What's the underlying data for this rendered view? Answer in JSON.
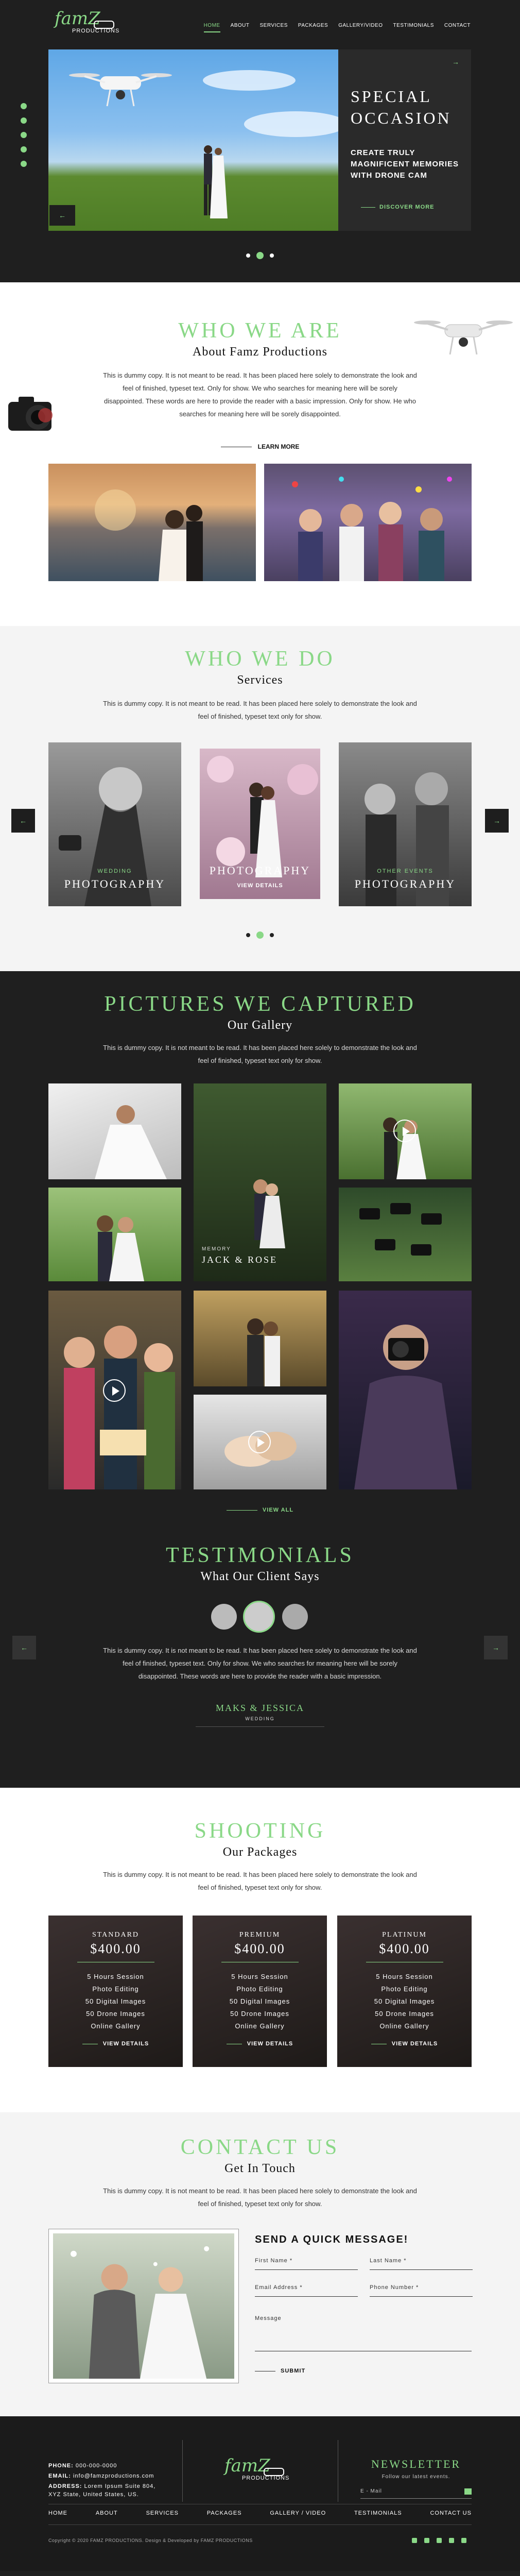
{
  "brand": {
    "script": "famZ",
    "sub": "PRODUCTIONS"
  },
  "nav": [
    "HOME",
    "ABOUT",
    "SERVICES",
    "PACKAGES",
    "GALLERY/VIDEO",
    "TESTIMONIALS",
    "CONTACT"
  ],
  "hero": {
    "title_line1": "SPECIAL",
    "title_line2": "OCCASION",
    "subtitle": "CREATE TRULY MAGNIFICENT MEMORIES WITH DRONE CAM",
    "cta": "DISCOVER MORE",
    "next_icon": "→",
    "prev_icon": "←"
  },
  "about": {
    "heading": "WHO WE ARE",
    "subheading": "About Famz Productions",
    "text": "This is dummy copy. It is not meant to be read. It has been placed here solely to demonstrate the look and feel of finished, typeset text. Only for show. We who searches for meaning here will be sorely disappointed. These words are here to provide the reader with a basic impression. Only for show. He who searches for meaning here will be sorely disappointed.",
    "cta": "LEARN MORE"
  },
  "services": {
    "heading": "WHO WE DO",
    "subheading": "Services",
    "text": "This is dummy copy. It is not meant to be read. It has been placed here solely to demonstrate the look and feel of finished, typeset text only for show.",
    "cards": [
      {
        "green": "WEDDING",
        "label": "PHOTOGRAPHY"
      },
      {
        "green": "",
        "label": "PHOTOGRAPHY",
        "cta": "VIEW DETAILS"
      },
      {
        "green": "OTHER EVENTS",
        "label": "PHOTOGRAPHY"
      }
    ]
  },
  "gallery": {
    "heading": "PICTURES WE CAPTURED",
    "subheading": "Our Gallery",
    "text": "This is dummy copy. It is not meant to be read. It has been placed here solely to demonstrate the look and feel of finished, typeset text only for show.",
    "memory_small": "MEMORY",
    "memory_title": "JACK & ROSE",
    "view_all": "VIEW ALL"
  },
  "testimonials": {
    "heading": "TESTIMONIALS",
    "subheading": "What Our Client Says",
    "text": "This is dummy copy. It is not meant to be read. It has been placed here solely to demonstrate the look and feel of finished, typeset text. Only for show. We who searches for meaning here will be sorely disappointed. These words are here to provide the reader with a basic impression.",
    "name": "MAKS & JESSICA",
    "role": "WEDDING"
  },
  "packages": {
    "heading": "SHOOTING",
    "subheading": "Our Packages",
    "text": "This is dummy copy. It is not meant to be read. It has been placed here solely to demonstrate the look and feel of finished, typeset text only for show.",
    "items": [
      {
        "name": "STANDARD",
        "price": "$400.00",
        "features": [
          "5 Hours Session",
          "Photo Editing",
          "50 Digital Images",
          "50 Drone Images",
          "Online Gallery"
        ],
        "cta": "VIEW DETAILS"
      },
      {
        "name": "PREMIUM",
        "price": "$400.00",
        "features": [
          "5 Hours Session",
          "Photo Editing",
          "50 Digital Images",
          "50 Drone Images",
          "Online Gallery"
        ],
        "cta": "VIEW DETAILS"
      },
      {
        "name": "PLATINUM",
        "price": "$400.00",
        "features": [
          "5 Hours Session",
          "Photo Editing",
          "50 Digital Images",
          "50 Drone Images",
          "Online Gallery"
        ],
        "cta": "VIEW DETAILS"
      }
    ]
  },
  "contact": {
    "heading": "CONTACT US",
    "subheading": "Get In Touch",
    "text": "This is dummy copy. It is not meant to be read. It has been placed here solely to demonstrate the look and feel of finished, typeset text only for show.",
    "form_title": "SEND A QUICK MESSAGE!",
    "first_name": "First Name *",
    "last_name": "Last Name *",
    "email": "Email Address *",
    "phone": "Phone Number *",
    "message": "Message",
    "submit": "SUBMIT"
  },
  "footer": {
    "phone_label": "PHONE:",
    "phone": "000-000-0000",
    "email_label": "EMAIL:",
    "email": "info@famzproductions.com",
    "address_label": "ADDRESS:",
    "address": "Lorem Ipsum Suite 804, XYZ State, United States, US.",
    "newsletter_title": "NEWSLETTER",
    "newsletter_sub": "Follow our latest events.",
    "newsletter_placeholder": "E - Mail",
    "nav": [
      "HOME",
      "ABOUT",
      "SERVICES",
      "PACKAGES",
      "GALLERY / VIDEO",
      "TESTIMONIALS",
      "CONTACT US"
    ],
    "copyright": "Copyright © 2020 FAMZ PRODUCTIONS. Design & Developed by FAMZ PRODUCTIONS"
  },
  "colors": {
    "accent": "#8ad887",
    "dark": "#1f1f1f",
    "panel": "#2a2a2a"
  }
}
